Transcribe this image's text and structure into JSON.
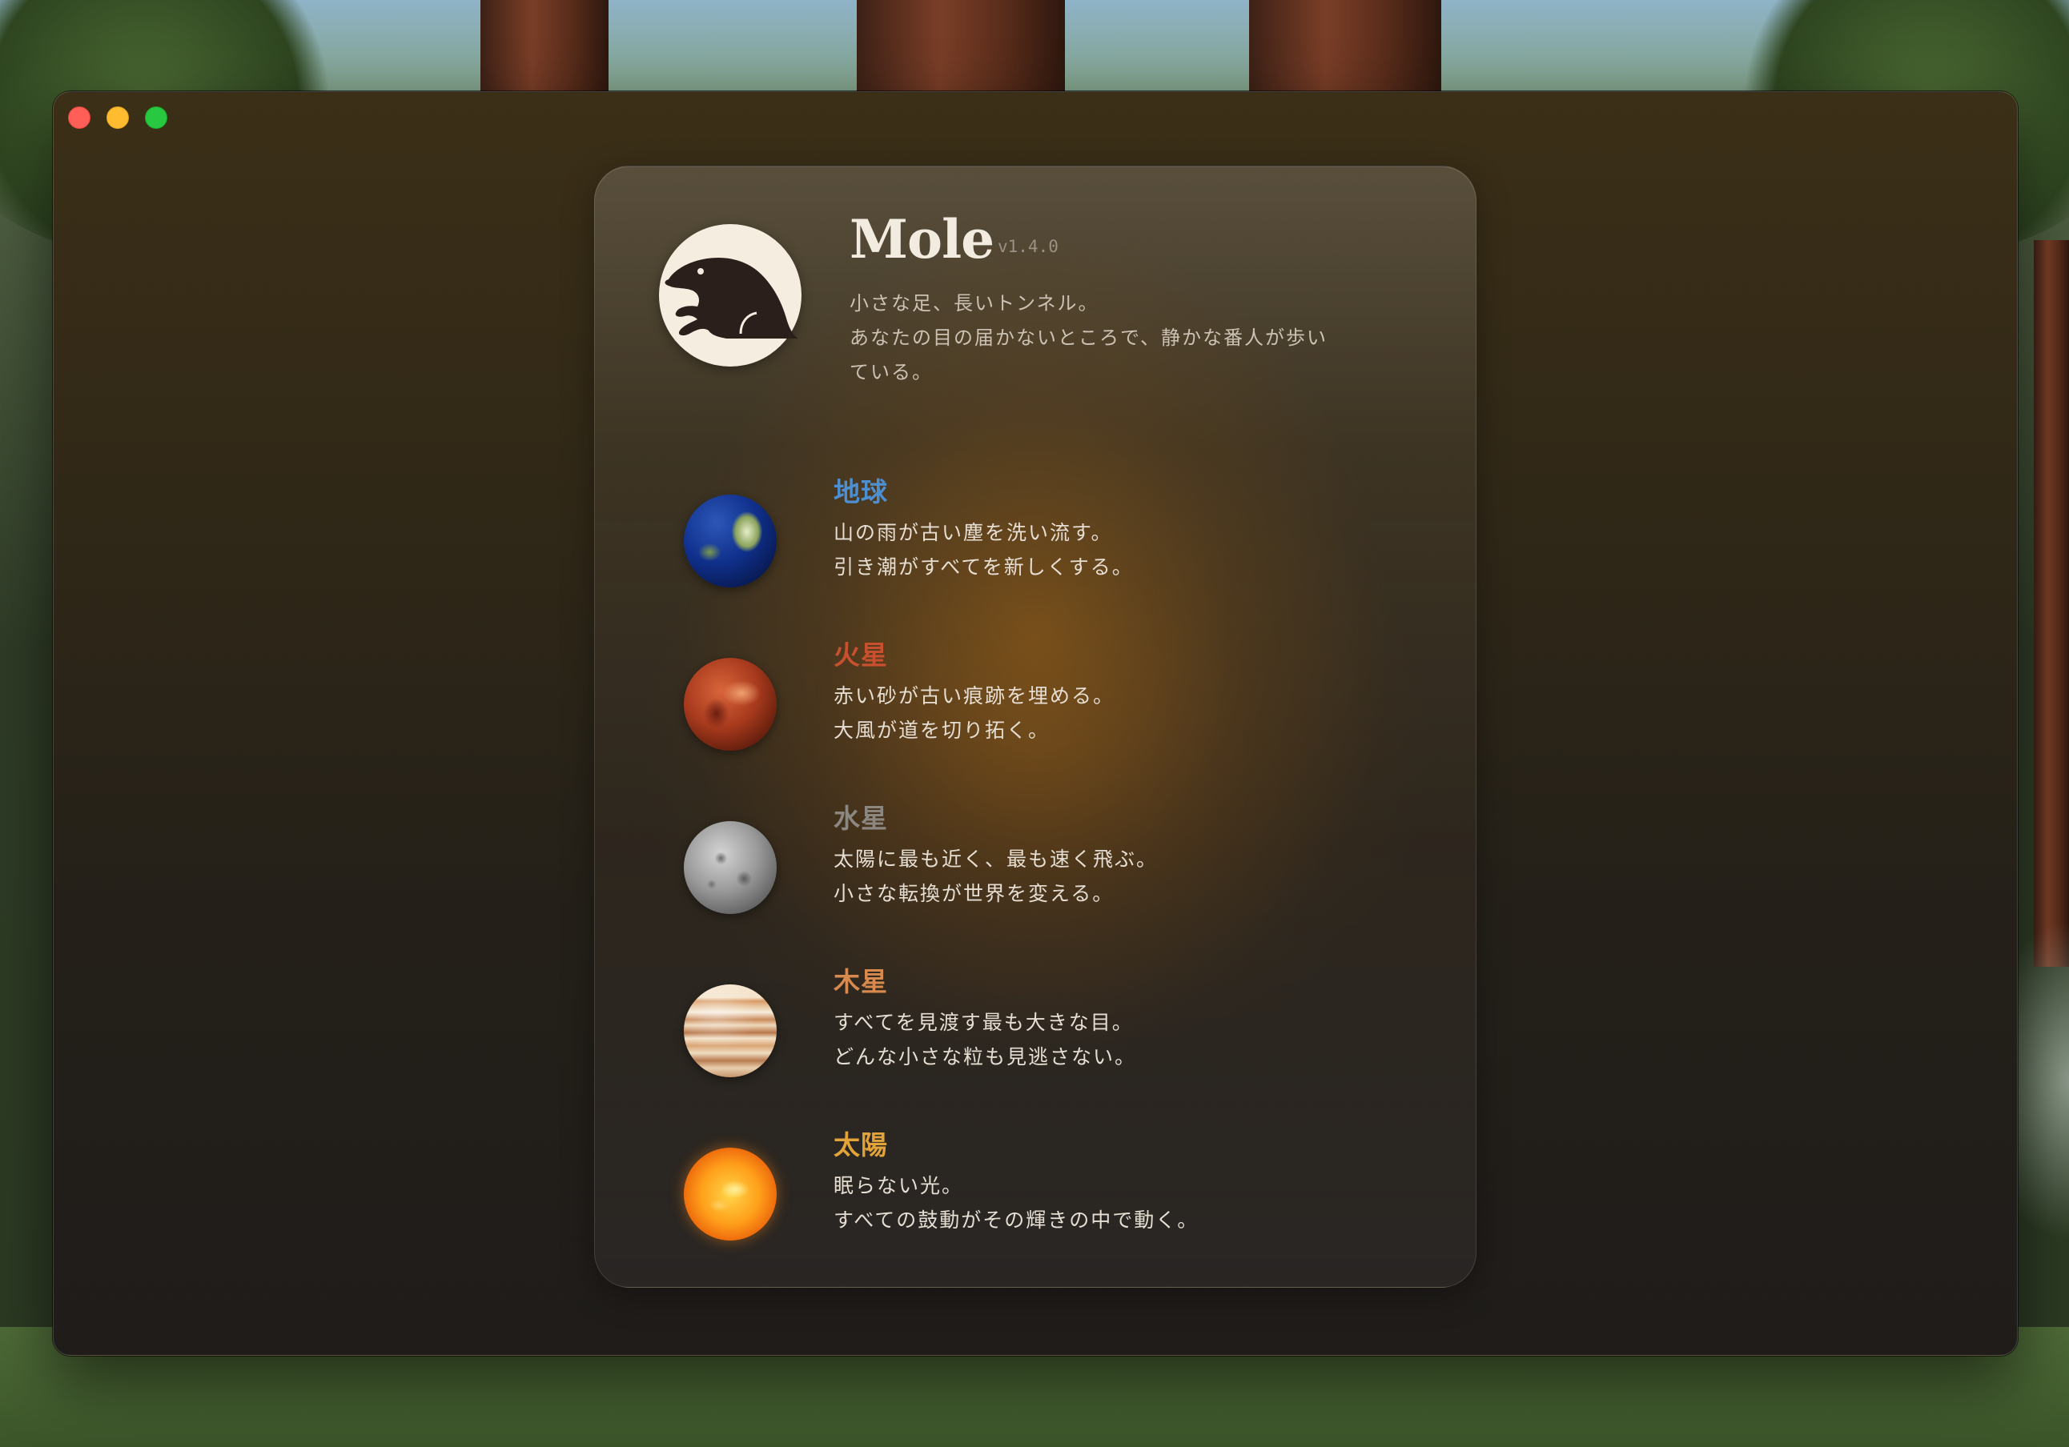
{
  "window": {
    "controls": [
      "close",
      "minimize",
      "zoom"
    ]
  },
  "app": {
    "name": "Mole",
    "version": "v1.4.0",
    "tagline": [
      "小さな足、長いトンネル。",
      "あなたの目の届かないところで、静かな番人が歩い",
      "ている。"
    ]
  },
  "planets": [
    {
      "name": "地球",
      "color": "#4d8fd1",
      "lines": [
        "山の雨が古い塵を洗い流す。",
        "引き潮がすべてを新しくする。"
      ]
    },
    {
      "name": "火星",
      "color": "#c8502f",
      "lines": [
        "赤い砂が古い痕跡を埋める。",
        "大風が道を切り拓く。"
      ]
    },
    {
      "name": "水星",
      "color": "#8c8780",
      "lines": [
        "太陽に最も近く、最も速く飛ぶ。",
        "小さな転換が世界を変える。"
      ]
    },
    {
      "name": "木星",
      "color": "#d88a4e",
      "lines": [
        "すべてを見渡す最も大きな目。",
        "どんな小さな粒も見逃さない。"
      ]
    },
    {
      "name": "太陽",
      "color": "#e2a43a",
      "lines": [
        "眠らない光。",
        "すべての鼓動がその輝きの中で動く。"
      ]
    }
  ]
}
